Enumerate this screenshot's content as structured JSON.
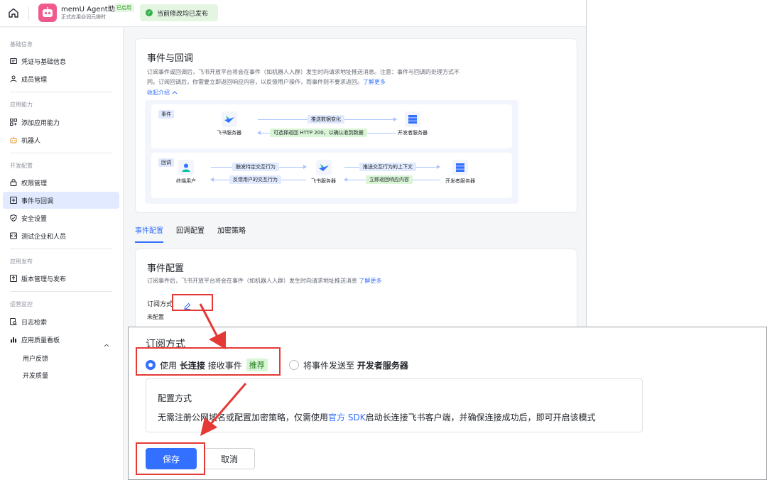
{
  "topbar": {
    "app_name": "memU Agent助手",
    "app_badge": "已启用",
    "app_subtitle": "正式应用@润元婵时",
    "status_text": "当前修改均已发布",
    "icons": {
      "home": "home-icon",
      "status": "check-circle-icon",
      "avatar": "robot-avatar"
    }
  },
  "sidebar": {
    "groups": [
      {
        "title": "基础信息",
        "items": [
          {
            "label": "凭证与基础信息",
            "icon": "id-card-icon"
          },
          {
            "label": "成员管理",
            "icon": "user-icon"
          }
        ]
      },
      {
        "title": "应用能力",
        "items": [
          {
            "label": "添加应用能力",
            "icon": "grid-plus-icon"
          },
          {
            "label": "机器人",
            "icon": "robot-icon"
          }
        ]
      },
      {
        "title": "开发配置",
        "items": [
          {
            "label": "权限管理",
            "icon": "lock-icon"
          },
          {
            "label": "事件与回调",
            "icon": "event-icon",
            "active": true
          },
          {
            "label": "安全设置",
            "icon": "shield-icon"
          },
          {
            "label": "测试企业和人员",
            "icon": "code-icon"
          }
        ]
      },
      {
        "title": "应用发布",
        "items": [
          {
            "label": "版本管理与发布",
            "icon": "upload-icon"
          }
        ]
      },
      {
        "title": "运营监控",
        "items": [
          {
            "label": "日志检索",
            "icon": "log-search-icon"
          },
          {
            "label": "应用质量看板",
            "icon": "bar-chart-icon",
            "expanded": true
          }
        ]
      }
    ],
    "sub_items": [
      "用户反馈",
      "开发质量"
    ]
  },
  "events_card": {
    "title": "事件与回调",
    "desc_line1": "订阅事件或回调后，飞书开放平台将会在事件（如机器人入群）发生时向请求地址推送消息。注意：事件与回调的处理方式不",
    "desc_line2_prefix": "同。订阅回调后，你需要立即返回响应内容，以反馈用户操作，而事件则不要求返回。",
    "learn_more": "了解更多",
    "collapse": "收起介绍"
  },
  "diagram": {
    "event_lane": {
      "tag": "事件",
      "left_node": "飞书服务器",
      "right_node": "开发者服务器",
      "arrow_top": "推送数据变化",
      "arrow_bottom": "可选择返回 HTTP 200，以确认收到数据"
    },
    "callback_lane": {
      "tag": "回调",
      "node_user": "终端用户",
      "node_feishu": "飞书服务器",
      "node_dev": "开发者服务器",
      "arrow_top_1": "触发特定交互行为",
      "arrow_bottom_1": "反馈用户的交互行为",
      "arrow_top_2": "推送交互行为的上下文",
      "arrow_bottom_2": "立即返回响应内容"
    }
  },
  "tabs": [
    "事件配置",
    "回调配置",
    "加密策略"
  ],
  "config_card": {
    "title": "事件配置",
    "desc_prefix": "订阅事件后，飞书开放平台将会在事件（如机器人入群）发生时向请求地址推送消息",
    "learn_more": "了解更多",
    "subscribe_label": "订阅方式",
    "not_configured": "未配置"
  },
  "popup": {
    "title": "订阅方式",
    "option1_prefix": "使用",
    "option1_bold": "长连接",
    "option1_suffix": "接收事件",
    "option1_tag": "推荐",
    "option2_prefix": "将事件发送至",
    "option2_bold": "开发者服务器",
    "method_title": "配置方式",
    "method_desc_prefix": "无需注册公网域名或配置加密策略，仅需使用",
    "method_desc_link": "官方 SDK",
    "method_desc_suffix": "启动长连接飞书客户端，并确保连接成功后，即可开启该模式",
    "save": "保存",
    "cancel": "取消"
  },
  "colors": {
    "accent": "#3370ff",
    "highlight_box": "#e53935",
    "success": "#34b14c",
    "active_nav_bg": "#e1eaff"
  }
}
